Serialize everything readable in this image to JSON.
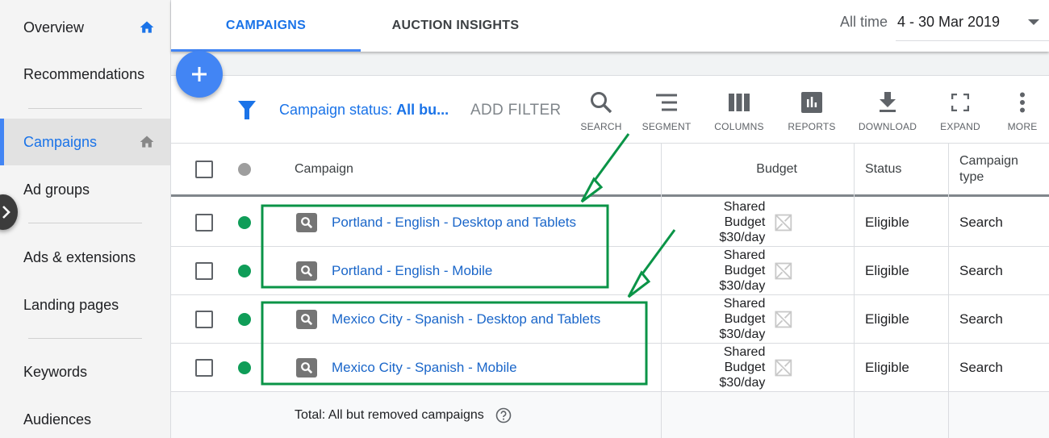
{
  "sidebar": {
    "items": [
      {
        "label": "Overview",
        "icon": "home-icon"
      },
      {
        "label": "Recommendations"
      },
      {
        "label": "Campaigns",
        "icon": "home-icon",
        "active": true
      },
      {
        "label": "Ad groups"
      },
      {
        "label": "Ads & extensions"
      },
      {
        "label": "Landing pages"
      },
      {
        "label": "Keywords"
      },
      {
        "label": "Audiences"
      }
    ],
    "expand_icon": "chevron-right-icon"
  },
  "tabs": [
    {
      "label": "CAMPAIGNS",
      "active": true
    },
    {
      "label": "AUCTION INSIGHTS",
      "active": false
    }
  ],
  "date_range": {
    "label": "All time",
    "value": "4 - 30 Mar 2019"
  },
  "toolbar": {
    "filter_prefix": "Campaign status: ",
    "filter_value": "All bu...",
    "add_filter": "ADD FILTER",
    "tools": [
      {
        "label": "SEARCH",
        "icon": "search-icon"
      },
      {
        "label": "SEGMENT",
        "icon": "segment-icon"
      },
      {
        "label": "COLUMNS",
        "icon": "columns-icon"
      },
      {
        "label": "REPORTS",
        "icon": "reports-icon"
      },
      {
        "label": "DOWNLOAD",
        "icon": "download-icon"
      },
      {
        "label": "EXPAND",
        "icon": "fullscreen-icon"
      },
      {
        "label": "MORE",
        "icon": "more-vert-icon"
      }
    ]
  },
  "table": {
    "headers": {
      "campaign": "Campaign",
      "budget": "Budget",
      "status": "Status",
      "campaign_type": "Campaign type"
    },
    "rows": [
      {
        "name": "Portland - English - Desktop and Tablets",
        "budget_line1": "Shared Budget",
        "budget_line2": "$30/day",
        "status": "Eligible",
        "type": "Search",
        "enabled": true
      },
      {
        "name": "Portland - English - Mobile",
        "budget_line1": "Shared Budget",
        "budget_line2": "$30/day",
        "status": "Eligible",
        "type": "Search",
        "enabled": true
      },
      {
        "name": "Mexico City - Spanish - Desktop and Tablets",
        "budget_line1": "Shared Budget",
        "budget_line2": "$30/day",
        "status": "Eligible",
        "type": "Search",
        "enabled": true
      },
      {
        "name": "Mexico City - Spanish - Mobile",
        "budget_line1": "Shared Budget",
        "budget_line2": "$30/day",
        "status": "Eligible",
        "type": "Search",
        "enabled": true
      }
    ],
    "total_label": "Total: All but removed campaigns"
  },
  "colors": {
    "accent": "#1a73e8",
    "fab": "#4285f4",
    "enabled_dot": "#0f9d58",
    "header_dot": "#9e9e9e",
    "annotation": "#0a9447"
  }
}
